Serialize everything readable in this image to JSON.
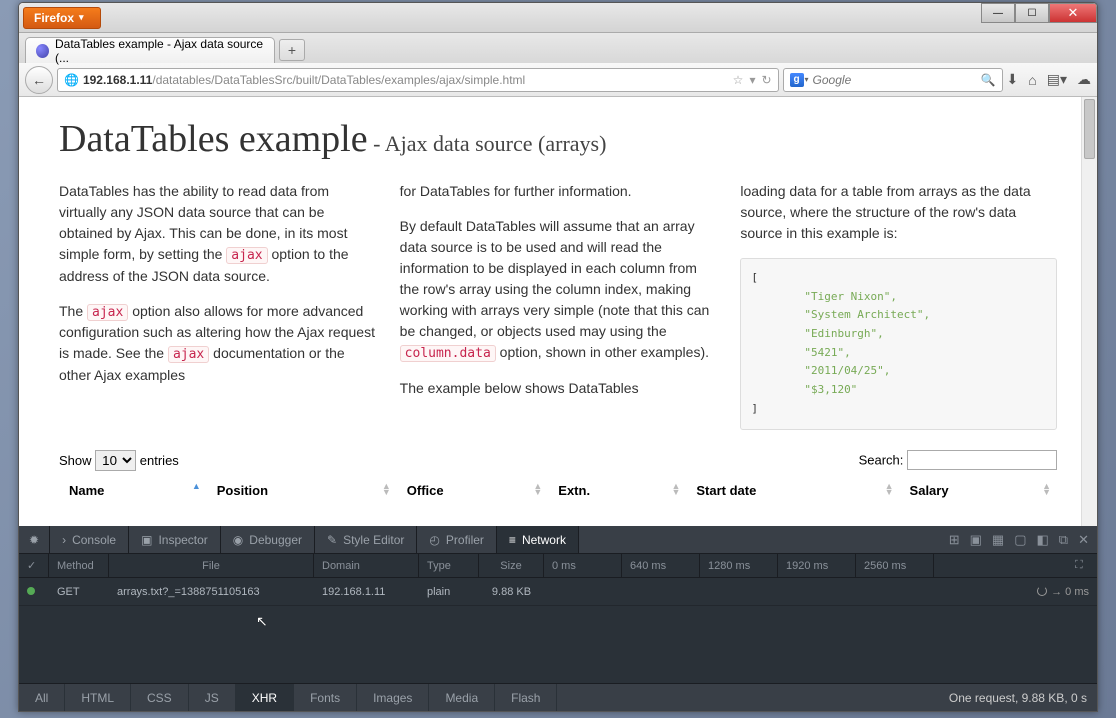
{
  "browser": {
    "menu_label": "Firefox",
    "tab_title": "DataTables example - Ajax data source (...",
    "url_host": "192.168.1.11",
    "url_path": "/datatables/DataTablesSrc/built/DataTables/examples/ajax/simple.html",
    "search_placeholder": "Google"
  },
  "page": {
    "heading_main": "DataTables example",
    "heading_sub": " - Ajax data source (arrays)",
    "col1_p1a": "DataTables has the ability to read data from virtually any JSON data source that can be obtained by Ajax. This can be done, in its most simple form, by setting the ",
    "kw_ajax": "ajax",
    "col1_p1b": " option to the address of the JSON data source.",
    "col1_p2a": "The ",
    "col1_p2b": " option also allows for more advanced configuration such as altering how the Ajax request is made. See the ",
    "col1_p2c": " documentation or the other Ajax examples",
    "col2_p1": "for DataTables for further information.",
    "col2_p2a": "By default DataTables will assume that an array data source is to be used and will read the information to be displayed in each column from the row's array using the column index, making working with arrays very simple (note that this can be changed, or objects used may using the ",
    "kw_column_data": "column.data",
    "col2_p2b": " option, shown in other examples).",
    "col2_p3": "The example below shows DataTables",
    "col3_p1": "loading data for a table from arrays as the data source, where the structure of the row's data source in this example is:",
    "example_row": [
      "\"Tiger Nixon\",",
      "\"System Architect\",",
      "\"Edinburgh\",",
      "\"5421\",",
      "\"2011/04/25\",",
      "\"$3,120\""
    ],
    "show_label": "Show",
    "entries_label": "entries",
    "show_value": "10",
    "search_label": "Search:",
    "columns": [
      "Name",
      "Position",
      "Office",
      "Extn.",
      "Start date",
      "Salary"
    ]
  },
  "devtools": {
    "tools": [
      "Console",
      "Inspector",
      "Debugger",
      "Style Editor",
      "Profiler",
      "Network"
    ],
    "headers": {
      "status": "✓",
      "method": "Method",
      "file": "File",
      "domain": "Domain",
      "type": "Type",
      "size": "Size"
    },
    "time_ticks": [
      "0 ms",
      "640 ms",
      "1280 ms",
      "1920 ms",
      "2560 ms"
    ],
    "row": {
      "method": "GET",
      "file": "arrays.txt?_=1388751105163",
      "domain": "192.168.1.11",
      "type": "plain",
      "size": "9.88 KB",
      "timing": "→ 0 ms"
    },
    "filters": [
      "All",
      "HTML",
      "CSS",
      "JS",
      "XHR",
      "Fonts",
      "Images",
      "Media",
      "Flash"
    ],
    "summary": "One request, 9.88 KB, 0 s"
  }
}
